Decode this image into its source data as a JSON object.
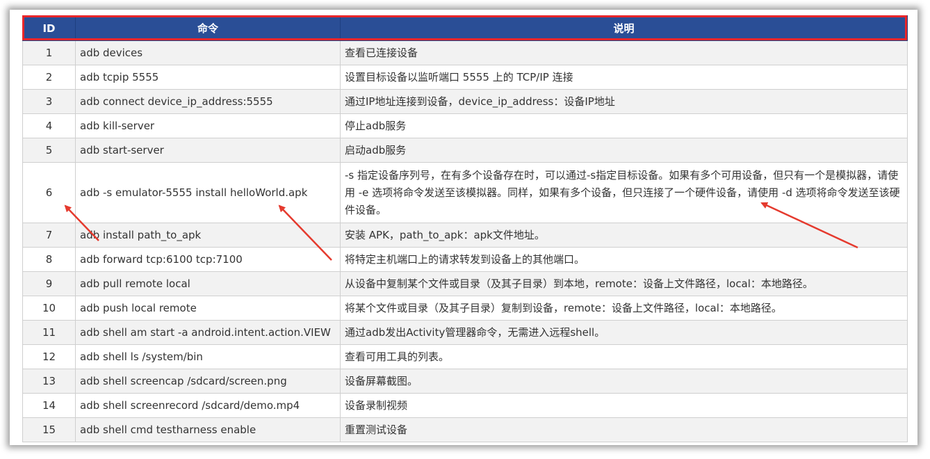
{
  "table": {
    "headers": {
      "id": "ID",
      "command": "命令",
      "description": "说明"
    },
    "rows": [
      {
        "id": "1",
        "command": "adb devices",
        "description": "查看已连接设备"
      },
      {
        "id": "2",
        "command": "adb tcpip 5555",
        "description": "设置目标设备以监听端口 5555 上的 TCP/IP 连接"
      },
      {
        "id": "3",
        "command": "adb connect device_ip_address:5555",
        "description": "通过IP地址连接到设备，device_ip_address：设备IP地址"
      },
      {
        "id": "4",
        "command": "adb kill-server",
        "description": "停止adb服务"
      },
      {
        "id": "5",
        "command": "adb start-server",
        "description": "启动adb服务"
      },
      {
        "id": "6",
        "command": "adb -s emulator-5555 install helloWorld.apk",
        "description": "-s 指定设备序列号，在有多个设备存在时，可以通过-s指定目标设备。如果有多个可用设备，但只有一个是模拟器，请使用 -e 选项将命令发送至该模拟器。同样，如果有多个设备，但只连接了一个硬件设备，请使用 -d 选项将命令发送至该硬件设备。"
      },
      {
        "id": "7",
        "command": "adb install path_to_apk",
        "description": "安装 APK，path_to_apk：apk文件地址。"
      },
      {
        "id": "8",
        "command": "adb forward tcp:6100 tcp:7100",
        "description": "将特定主机端口上的请求转发到设备上的其他端口。"
      },
      {
        "id": "9",
        "command": "adb pull remote local",
        "description": "从设备中复制某个文件或目录（及其子目录）到本地，remote：设备上文件路径，local：本地路径。"
      },
      {
        "id": "10",
        "command": "adb push local remote",
        "description": "将某个文件或目录（及其子目录）复制到设备，remote：设备上文件路径，local：本地路径。"
      },
      {
        "id": "11",
        "command": "adb shell am start -a android.intent.action.VIEW",
        "description": "通过adb发出Activity管理器命令，无需进入远程shell。"
      },
      {
        "id": "12",
        "command": "adb shell ls /system/bin",
        "description": "查看可用工具的列表。"
      },
      {
        "id": "13",
        "command": "adb shell screencap /sdcard/screen.png",
        "description": "设备屏幕截图。"
      },
      {
        "id": "14",
        "command": "adb shell screenrecord /sdcard/demo.mp4",
        "description": "设备录制视频"
      },
      {
        "id": "15",
        "command": "adb shell cmd testharness enable",
        "description": "重置测试设备"
      }
    ]
  },
  "colors": {
    "header_bg": "#2a4e96",
    "header_outline": "#e8262a",
    "annotation_arrow": "#e53a2e",
    "row_alt_bg": "#f2f2f2"
  }
}
